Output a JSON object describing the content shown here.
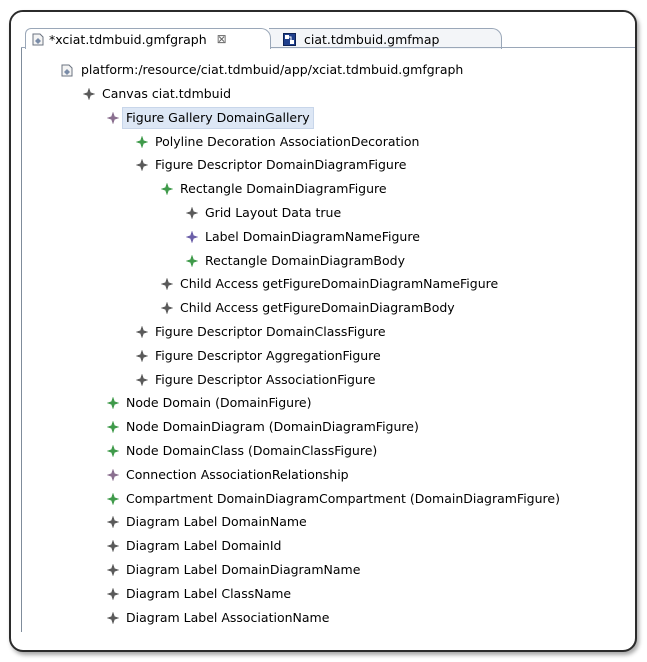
{
  "colors": {
    "diamond_gray": "#5a5a5a",
    "diamond_green": "#3f9a4a",
    "diamond_purple": "#6b5fa8",
    "diamond_mauve": "#8a6f8f",
    "selection": "#dde7f5"
  },
  "tabs": [
    {
      "label": "*xciat.tdmbuid.gmfgraph",
      "icon": "gmfgraph-file-icon",
      "active": true
    },
    {
      "label": "ciat.tdmbuid.gmfmap",
      "icon": "gmfmap-file-icon",
      "active": false
    }
  ],
  "tree": {
    "root": "platform:/resource/ciat.tdmbuid/app/xciat.tdmbuid.gmfgraph",
    "items": [
      {
        "label": "Canvas ciat.tdmbuid",
        "icon": "diamond-gray"
      },
      {
        "label": "Figure Gallery DomainGallery",
        "icon": "diamond-mauve",
        "selected": true
      },
      {
        "label": "Polyline Decoration AssociationDecoration",
        "icon": "diamond-green"
      },
      {
        "label": "Figure Descriptor DomainDiagramFigure",
        "icon": "diamond-gray"
      },
      {
        "label": "Rectangle DomainDiagramFigure",
        "icon": "diamond-green"
      },
      {
        "label": "Grid Layout Data true",
        "icon": "diamond-gray"
      },
      {
        "label": "Label DomainDiagramNameFigure",
        "icon": "diamond-purple"
      },
      {
        "label": "Rectangle DomainDiagramBody",
        "icon": "diamond-green"
      },
      {
        "label": "Child Access getFigureDomainDiagramNameFigure",
        "icon": "diamond-gray"
      },
      {
        "label": "Child Access getFigureDomainDiagramBody",
        "icon": "diamond-gray"
      },
      {
        "label": "Figure Descriptor DomainClassFigure",
        "icon": "diamond-gray"
      },
      {
        "label": "Figure Descriptor AggregationFigure",
        "icon": "diamond-gray"
      },
      {
        "label": "Figure Descriptor AssociationFigure",
        "icon": "diamond-gray"
      },
      {
        "label": "Node Domain (DomainFigure)",
        "icon": "diamond-green"
      },
      {
        "label": "Node DomainDiagram (DomainDiagramFigure)",
        "icon": "diamond-green"
      },
      {
        "label": "Node DomainClass (DomainClassFigure)",
        "icon": "diamond-green"
      },
      {
        "label": "Connection AssociationRelationship",
        "icon": "diamond-mauve"
      },
      {
        "label": "Compartment DomainDiagramCompartment (DomainDiagramFigure)",
        "icon": "diamond-green"
      },
      {
        "label": "Diagram Label DomainName",
        "icon": "diamond-gray"
      },
      {
        "label": "Diagram Label DomainId",
        "icon": "diamond-gray"
      },
      {
        "label": "Diagram Label DomainDiagramName",
        "icon": "diamond-gray"
      },
      {
        "label": "Diagram Label ClassName",
        "icon": "diamond-gray"
      },
      {
        "label": "Diagram Label AssociationName",
        "icon": "diamond-gray"
      }
    ]
  }
}
